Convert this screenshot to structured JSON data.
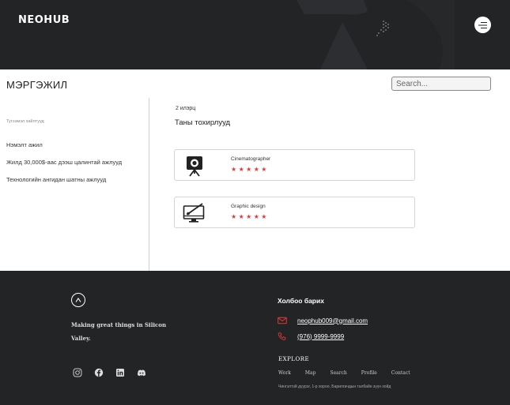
{
  "header": {
    "logo_text": "NEOHUB"
  },
  "page": {
    "title": "МЭРГЭЖИЛ"
  },
  "search": {
    "placeholder": "Search..."
  },
  "sidebar": {
    "heading": "Тугээмэл хайлтууд",
    "items": [
      {
        "label": "Нэмэлт ажил"
      },
      {
        "label": "Жилд 30,000$-аас дээш цалинтай ажлууд"
      },
      {
        "label": "Технологийн ангидан шатны ажлууд"
      }
    ]
  },
  "main": {
    "count_label": "2 илэрц",
    "section_title": "Таны тохирлууд",
    "cards": [
      {
        "name": "Cinematographer",
        "icon": "camera-tripod-icon",
        "rating": 5,
        "stars": "★★★★★"
      },
      {
        "name": "Graphic design",
        "icon": "monitor-brush-icon",
        "rating": 5,
        "stars": "★★★★★"
      }
    ]
  },
  "footer": {
    "tagline": "Making great things in Silicon Valley.",
    "contact_title": "Холбоо барих",
    "email": "neophub009@gmail.com",
    "phone": "(976) 9999-9999",
    "explore_title": "EXPLORE",
    "explore_links": [
      "Work",
      "Map",
      "Search",
      "Profile",
      "Contact"
    ],
    "address": "Чингэлтэй дүүрэг, 1-р хороо, Барилгачдын талбайн зүүн хойд"
  },
  "colors": {
    "dark": "#222426",
    "star": "#e53935",
    "accent_red": "#e53935"
  }
}
